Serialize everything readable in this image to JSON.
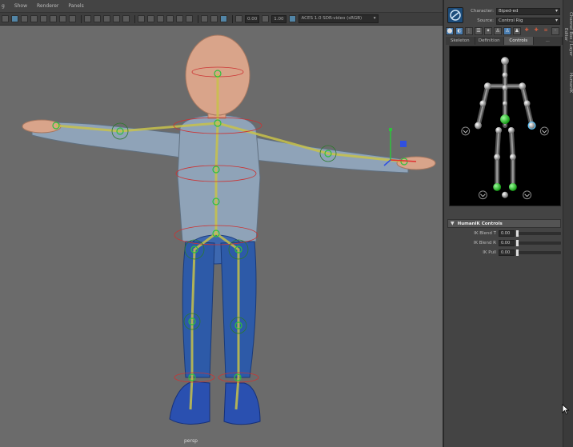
{
  "menu": [
    "g",
    "Show",
    "Renderer",
    "Panels"
  ],
  "toolbar": {
    "field_a": "0.00",
    "field_b": "1.00",
    "colorspace": "ACES 1.0 SDR-video (sRGB)"
  },
  "viewport": {
    "camera_label": "persp"
  },
  "hik": {
    "character_label": "Character:",
    "character_value": "Biped-ed",
    "source_label": "Source:",
    "source_value": "Control Rig",
    "tabs": [
      "Skeleton",
      "Definition",
      "Controls",
      "..."
    ],
    "active_tab": 2
  },
  "humanik_controls": {
    "title": "HumanIK Controls",
    "rows": [
      {
        "label": "IK Blend T",
        "value": "0.00",
        "level": 0.0
      },
      {
        "label": "IK Blend R",
        "value": "0.00",
        "level": 0.0
      },
      {
        "label": "IK Pull",
        "value": "0.00",
        "level": 0.0
      }
    ]
  },
  "side_tabs": [
    "Channel Box / Layer Editor",
    "HumanIK"
  ],
  "colors": {
    "viewport_bg": "#6b6b6b",
    "panel_bg": "#444444",
    "accent": "#5285a6",
    "shirt": "#8fa3b8",
    "pants": "#2d5aa8",
    "skin": "#d9a48a",
    "joint_green": "#2ec23c",
    "bone_yellow": "#c8c24a"
  },
  "icons": [
    "select-icon",
    "lasso-icon",
    "paint-icon",
    "move-icon",
    "rotate-icon",
    "scale-icon",
    "camera-icon",
    "grid-icon",
    "wireframe-icon",
    "shaded-icon",
    "light-icon",
    "hik-logo-icon",
    "full-body-icon",
    "body-part-icon",
    "pin-icon",
    "reset-icon",
    "key-icon"
  ]
}
